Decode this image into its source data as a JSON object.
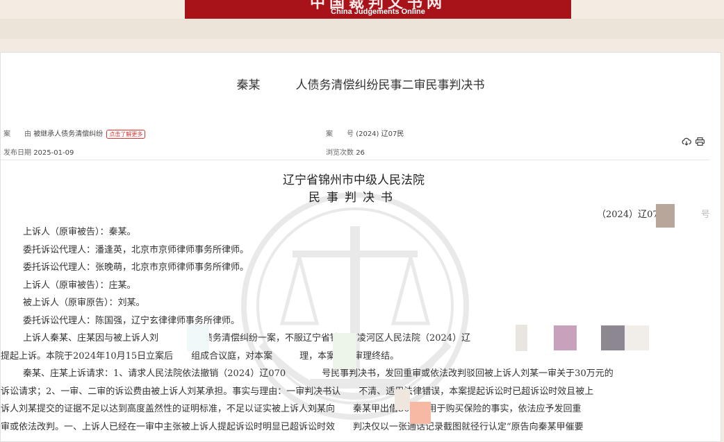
{
  "site": {
    "name_cn": "中国裁判文书网",
    "name_en": "China Judgements Online",
    "colors": {
      "banner_red": "#a8131a",
      "tag_red": "#d33333"
    }
  },
  "document": {
    "title": "秦某　　　人债务清偿纠纷民事二审民事判决书",
    "case_cause_label": "案　　由",
    "case_cause_value": "被继承人债务清偿纠纷",
    "learn_more": "点击了解更多",
    "case_no_label": "案　　号",
    "case_no_value": "(2024) 辽07民",
    "publish_date_label": "发布日期",
    "publish_date_value": "2025-01-09",
    "views_label": "浏览次数",
    "views_value": "26",
    "icons": [
      "download-cloud-icon",
      "print-icon"
    ]
  },
  "judgment": {
    "court": "辽宁省锦州市中级人民法院",
    "doc_type": "民事判决书",
    "case_number": "（2024）辽07民",
    "case_number_tail": "号",
    "parties": [
      "上诉人（原审被告）：秦某。",
      "委托诉讼代理人：潘逢英，北京市京师律师事务所律师。",
      "委托诉讼代理人：张晚萌，北京市京师律师事务所律师。",
      "上诉人（原审被告）：庄某。",
      "被上诉人（原审原告）：刘某。",
      "委托诉讼代理人：陈国强，辽宁玄律律师事务所律师。"
    ],
    "paragraphs": [
      "上诉人秦某、庄某因与被上诉人刘　　　　人债务清偿纠纷一案，不服辽宁省锦州市凌河区人民法院（2024）辽　　　　　　　　　　　　　　　向本院",
      "提起上诉。本院于2024年10月15日立案后　　组成合议庭，对本案　　　理，本案现已审理终结。",
      "秦某、庄某上诉请求：1、请求人民法院依法撤销（2024）辽070　　　　号民事判决书，发回重审或依法改判驳回被上诉人刘某一审关于30万元的",
      "诉讼请求；2、一审、二审的诉讼费由被上诉人刘某承担。事实与理由：一审判决书认　　不清、适用法律错误，本案提起诉讼时已超诉讼时效且被上",
      "诉人刘某提交的证据不足以达到高度盖然性的证明标准，不足以证实被上诉人刘某向　　秦某甲出借30万元用于购买保险的事实，依法应予发回重",
      "审或依法改判。一、上诉人已经在一审中主张被上诉人提起诉讼时明显已超诉讼时效　　判决仅以一张通话记录截图就径行认定“原告向秦某甲催要"
    ]
  }
}
